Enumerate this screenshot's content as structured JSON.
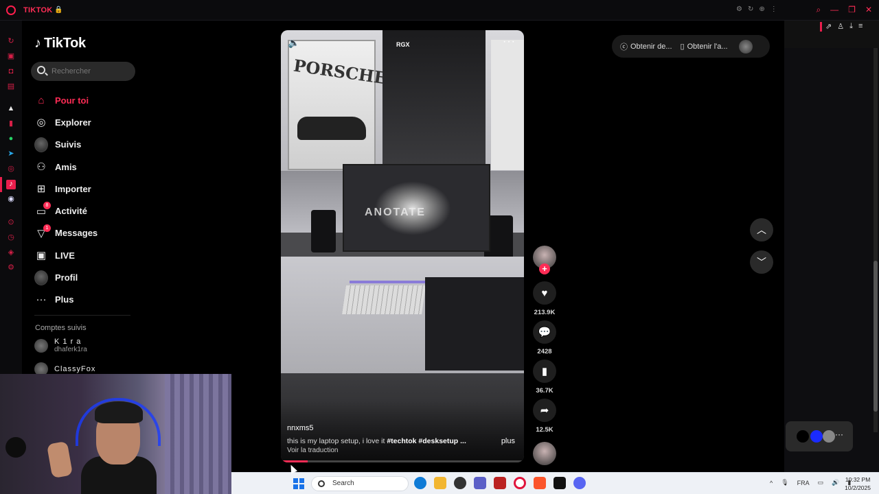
{
  "browser": {
    "tab_title": "TIKTOK",
    "lock_icon": "lock-icon",
    "toolbar_icons": [
      "settings-icon",
      "reload-icon",
      "pin-icon",
      "menu-dots-icon"
    ],
    "window_controls": [
      "search-icon",
      "minimize-icon",
      "restore-icon",
      "close-icon"
    ],
    "accent": "#fe2c55"
  },
  "sidebar": {
    "logo": "TikTok",
    "search_placeholder": "Rechercher",
    "items": [
      {
        "label": "Pour toi",
        "icon": "home-icon",
        "active": true
      },
      {
        "label": "Explorer",
        "icon": "compass-icon"
      },
      {
        "label": "Suivis",
        "icon": "following-avatar"
      },
      {
        "label": "Amis",
        "icon": "friends-icon"
      },
      {
        "label": "Importer",
        "icon": "upload-icon"
      },
      {
        "label": "Activité",
        "icon": "activity-icon",
        "badge": "8"
      },
      {
        "label": "Messages",
        "icon": "messages-icon",
        "badge": "1"
      },
      {
        "label": "LIVE",
        "icon": "live-icon"
      },
      {
        "label": "Profil",
        "icon": "profile-avatar"
      },
      {
        "label": "Plus",
        "icon": "more-icon"
      }
    ],
    "following_title": "Comptes suivis",
    "following": [
      {
        "name": "K 1 r a",
        "handle": "dhaferk1ra"
      },
      {
        "name": "ClassyFox",
        "handle": ""
      }
    ]
  },
  "topbar": {
    "get_coins": "Obtenir de...",
    "get_app": "Obtenir l'a..."
  },
  "video": {
    "watermark": "RGX",
    "poster_text": "PORSCHE",
    "monitor_text": "ANOTATE",
    "author": "nnxms5",
    "caption": "this is my laptop setup, i love it",
    "hashtags": "#techtok #desksetup ...",
    "more": "plus",
    "translate": "Voir la traduction",
    "progress": 0.11
  },
  "actions": {
    "likes": "213.9K",
    "comments": "2428",
    "saves": "36.7K",
    "shares": "12.5K"
  },
  "taskbar": {
    "search": "Search",
    "language": "FRA",
    "time": "10:32 PM",
    "date": "10/2/2025"
  }
}
